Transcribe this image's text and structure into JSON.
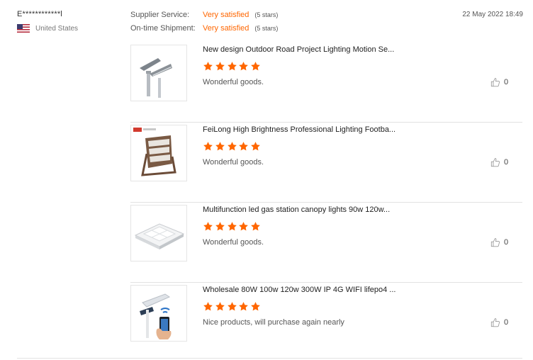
{
  "reviewer": {
    "name": "E************l",
    "country": "United States"
  },
  "ratings": [
    {
      "label": "Supplier Service:",
      "value": "Very satisfied",
      "stars_text": "(5 stars)"
    },
    {
      "label": "On-time Shipment:",
      "value": "Very satisfied",
      "stars_text": "(5 stars)"
    }
  ],
  "timestamp": "22 May 2022 18:49",
  "accent_color": "#ff6600",
  "products": [
    {
      "title": "New design Outdoor Road Project Lighting Motion Se...",
      "rating": 5,
      "comment": "Wonderful goods.",
      "likes": "0"
    },
    {
      "title": "FeiLong High Brightness Professional Lighting Footba...",
      "rating": 5,
      "comment": "Wonderful goods.",
      "likes": "0"
    },
    {
      "title": "Multifunction led gas station canopy lights 90w 120w...",
      "rating": 5,
      "comment": "Wonderful goods.",
      "likes": "0"
    },
    {
      "title": "Wholesale 80W 100w 120w 300W IP 4G WIFI lifepo4 ...",
      "rating": 5,
      "comment": "Nice products, will purchase again nearly",
      "likes": "0"
    }
  ],
  "icons": {
    "flag": "us-flag-icon",
    "star": "star-icon",
    "like": "thumbs-up-icon"
  }
}
